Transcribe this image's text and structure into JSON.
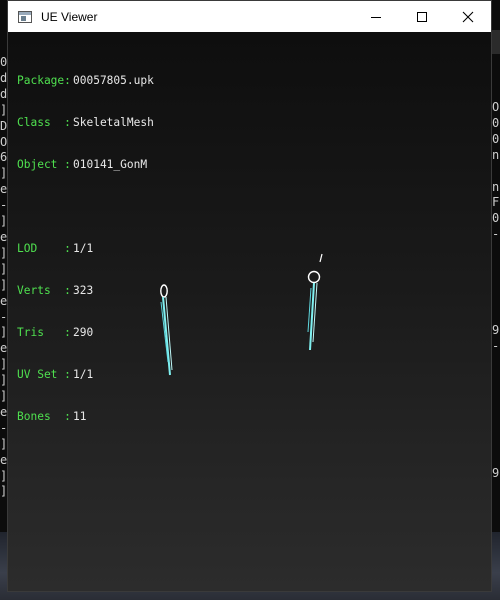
{
  "window": {
    "title": "UE Viewer",
    "controls": {
      "minimize": "—",
      "maximize": "☐",
      "close": "✕"
    }
  },
  "background_console": {
    "left_chars": [
      "0",
      "d",
      "d",
      "]",
      "D",
      "O",
      "6",
      "]",
      "e",
      "-",
      "]",
      "e",
      "]",
      "]",
      "]",
      "e",
      "-",
      "]",
      "e",
      "]",
      "]",
      "]",
      "e",
      "-",
      "]",
      "e",
      "]",
      "]"
    ],
    "right_chars": [
      "O",
      "0",
      "0",
      "n",
      "",
      "n",
      "F",
      "0",
      "-",
      "",
      "",
      "",
      "",
      "",
      "9",
      "-",
      "",
      "",
      "",
      "",
      "",
      "",
      "",
      "9",
      "-"
    ]
  },
  "info": {
    "package": {
      "label": "Package:",
      "value": "00057805.upk"
    },
    "class": {
      "label": "Class  :",
      "value": "SkeletalMesh"
    },
    "object": {
      "label": "Object :",
      "value": "010141_GonM"
    },
    "lod": {
      "label": "LOD    :",
      "value": "1/1"
    },
    "verts": {
      "label": "Verts  :",
      "value": "323"
    },
    "tris": {
      "label": "Tris   :",
      "value": "290"
    },
    "uvset": {
      "label": "UV Set :",
      "value": "1/1"
    },
    "bones": {
      "label": "Bones  :",
      "value": "11"
    }
  },
  "colors": {
    "label_green": "#4fe04f",
    "mesh_cyan": "#7ff0f0",
    "mesh_white": "#ffffff"
  }
}
